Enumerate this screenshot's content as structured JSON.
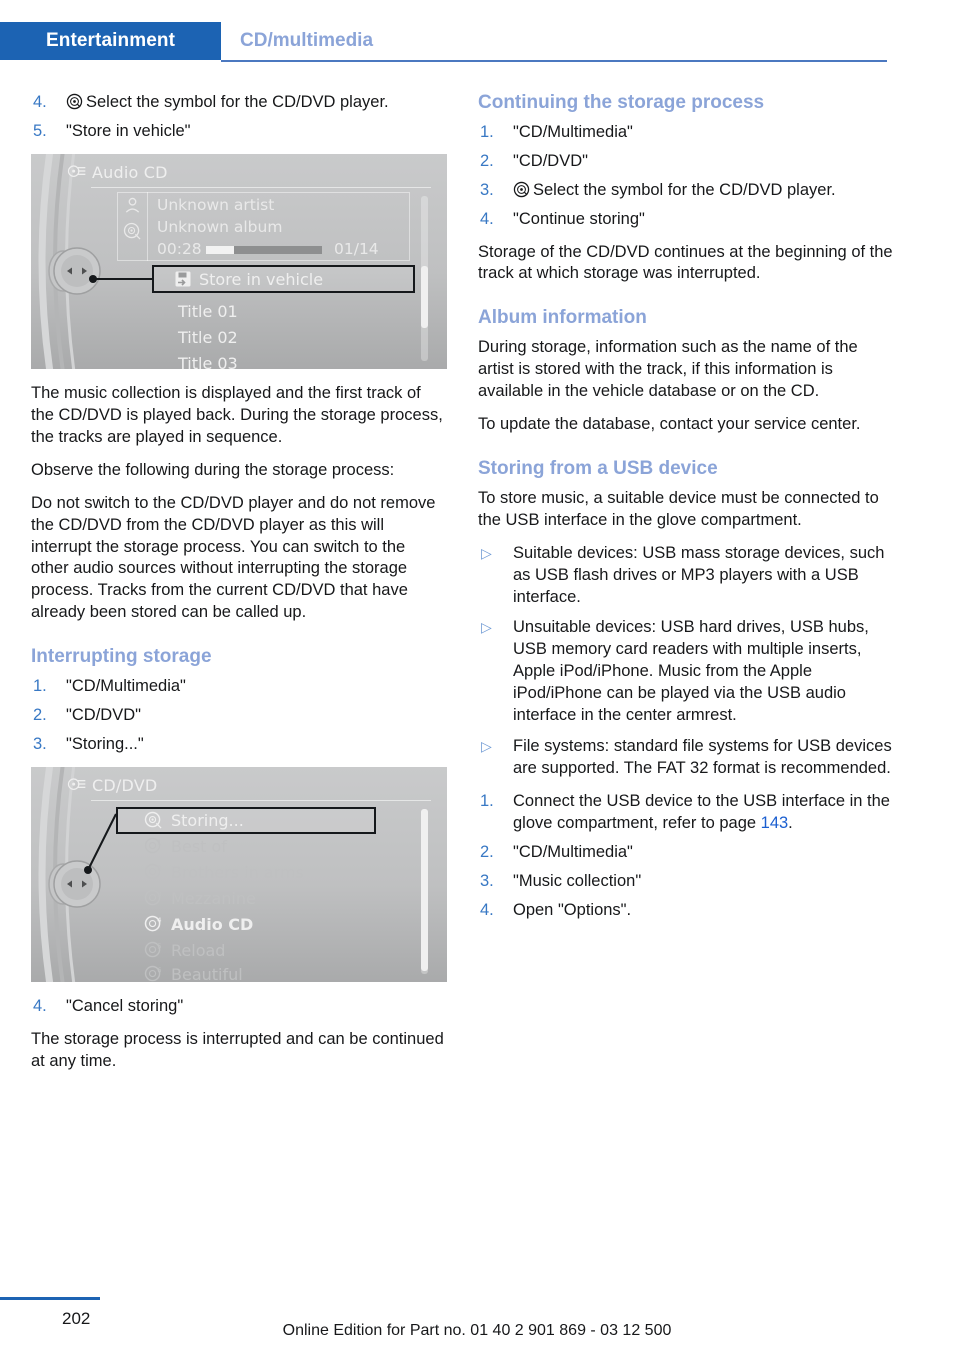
{
  "header": {
    "tab_label": "Entertainment",
    "section_label": "CD/multimedia",
    "tab_color": "#1c63b3",
    "section_color": "#8ba4d8"
  },
  "left_column": {
    "top_steps": [
      {
        "num": "4.",
        "icon": "cd-disc-icon",
        "text": "Select the symbol for the CD/DVD player."
      },
      {
        "num": "5.",
        "text": "\"Store in vehicle\""
      }
    ],
    "screen_audio_cd": {
      "title": "Audio CD",
      "head_icon": "music-note-cd-icon",
      "artist_icon": "person-icon",
      "album_icon": "cd-disc-icon",
      "artist": "Unknown artist",
      "album": "Unknown album",
      "time": "00:28",
      "track_count": "01/14",
      "progress_percent": 24,
      "selected_item": "Store in vehicle",
      "selected_icon": "save-to-vehicle-icon",
      "rows": [
        "Title  01",
        "Title  02",
        "Title  03"
      ]
    },
    "paragraphs": [
      "The music collection is displayed and the first track of the CD/DVD is played back. During the storage process, the tracks are played in sequence.",
      "Observe the following during the storage process:",
      "Do not switch to the CD/DVD player and do not remove the CD/DVD from the CD/DVD player as this will interrupt the storage process. You can switch to the other audio sources without interrupting the storage process. Tracks from the current CD/DVD that have already been stored can be called up."
    ],
    "interrupting_heading": "Interrupting storage",
    "interrupting_steps": [
      {
        "num": "1.",
        "text": "\"CD/Multimedia\""
      },
      {
        "num": "2.",
        "text": "\"CD/DVD\""
      },
      {
        "num": "3.",
        "text": "\"Storing...\""
      }
    ],
    "screen_cd_dvd": {
      "title": "CD/DVD",
      "head_icon": "music-note-cd-icon",
      "selected_item": "Storing...",
      "rows": [
        {
          "label": "Storing...",
          "icon": "cd-disc-icon",
          "state": "selected"
        },
        {
          "label": "Best of",
          "icon": "cd-disc-1-icon",
          "state": "dim"
        },
        {
          "label": "Brothers in arms",
          "icon": "cd-disc-2-icon",
          "state": "dim"
        },
        {
          "label": "Mezzanine",
          "icon": "cd-disc-3-icon",
          "state": "dim"
        },
        {
          "label": "Audio CD",
          "icon": "cd-disc-4-icon",
          "state": "active"
        },
        {
          "label": "Reload",
          "icon": "cd-disc-5-icon",
          "state": "dim"
        },
        {
          "label": "Beautiful",
          "icon": "cd-disc-6-icon",
          "state": "dim"
        }
      ]
    },
    "cancel_step": {
      "num": "4.",
      "text": "\"Cancel storing\""
    },
    "closing_paragraph": "The storage process is interrupted and can be continued at any time."
  },
  "right_column": {
    "continuing_heading": "Continuing the storage process",
    "continuing_steps": [
      {
        "num": "1.",
        "text": "\"CD/Multimedia\""
      },
      {
        "num": "2.",
        "text": "\"CD/DVD\""
      },
      {
        "num": "3.",
        "icon": "cd-disc-icon",
        "text": "Select the symbol for the CD/DVD player."
      },
      {
        "num": "4.",
        "text": "\"Continue storing\""
      }
    ],
    "continuing_paragraph": "Storage of the CD/DVD continues at the beginning of the track at which storage was interrupted.",
    "album_heading": "Album information",
    "album_paragraphs": [
      "During storage, information such as the name of the artist is stored with the track, if this information is available in the vehicle database or on the CD.",
      "To update the database, contact your service center."
    ],
    "usb_heading": "Storing from a USB device",
    "usb_intro": "To store music, a suitable device must be connected to the USB interface in the glove compartment.",
    "usb_bullets": [
      "Suitable devices: USB mass storage devices, such as USB flash drives or MP3 players with a USB interface.",
      "Unsuitable devices: USB hard drives, USB hubs, USB memory card readers with multiple inserts, Apple iPod/iPhone. Music from the Apple iPod/iPhone can be played via the USB audio interface in the center armrest.",
      "File systems: standard file systems for USB devices are supported. The FAT 32 format is recommended."
    ],
    "usb_steps": [
      {
        "num": "1.",
        "text_before": "Connect the USB device to the USB interface in the glove compartment, refer to page ",
        "page_ref": "143",
        "text_after": "."
      },
      {
        "num": "2.",
        "text": "\"CD/Multimedia\""
      },
      {
        "num": "3.",
        "text": "\"Music collection\""
      },
      {
        "num": "4.",
        "text": "Open \"Options\"."
      }
    ]
  },
  "footer": {
    "page_number": "202",
    "edition": "Online Edition for Part no. 01 40 2 901 869 - 03 12 500"
  }
}
